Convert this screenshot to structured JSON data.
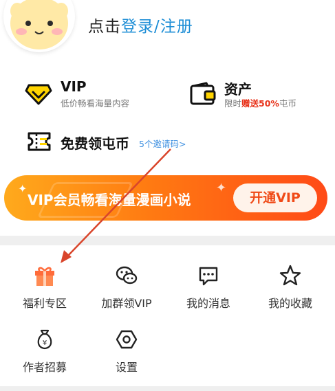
{
  "header": {
    "login_prefix": "点击",
    "login_link": "登录/注册"
  },
  "vip": {
    "title": "VIP",
    "subtitle": "低价畅看海量内容"
  },
  "assets": {
    "title": "资产",
    "sub_prefix": "限时",
    "sub_highlight": "赠送50%",
    "sub_suffix": "屯币"
  },
  "coins": {
    "title": "免费领屯币",
    "invite_link": "5个邀请码>"
  },
  "banner": {
    "text": "VIP会员畅看海量漫画小说",
    "button": "开通VIP"
  },
  "grid": {
    "items": [
      {
        "label": "福利专区",
        "icon": "gift-icon"
      },
      {
        "label": "加群领VIP",
        "icon": "wechat-icon"
      },
      {
        "label": "我的消息",
        "icon": "message-icon"
      },
      {
        "label": "我的收藏",
        "icon": "star-icon"
      },
      {
        "label": "作者招募",
        "icon": "money-bag-icon"
      },
      {
        "label": "设置",
        "icon": "settings-icon"
      }
    ]
  },
  "colors": {
    "accent_blue": "#1e8ed6",
    "highlight_red": "#e8341c",
    "banner_orange": "#ff7a12",
    "annotation_arrow": "#d9452b"
  }
}
